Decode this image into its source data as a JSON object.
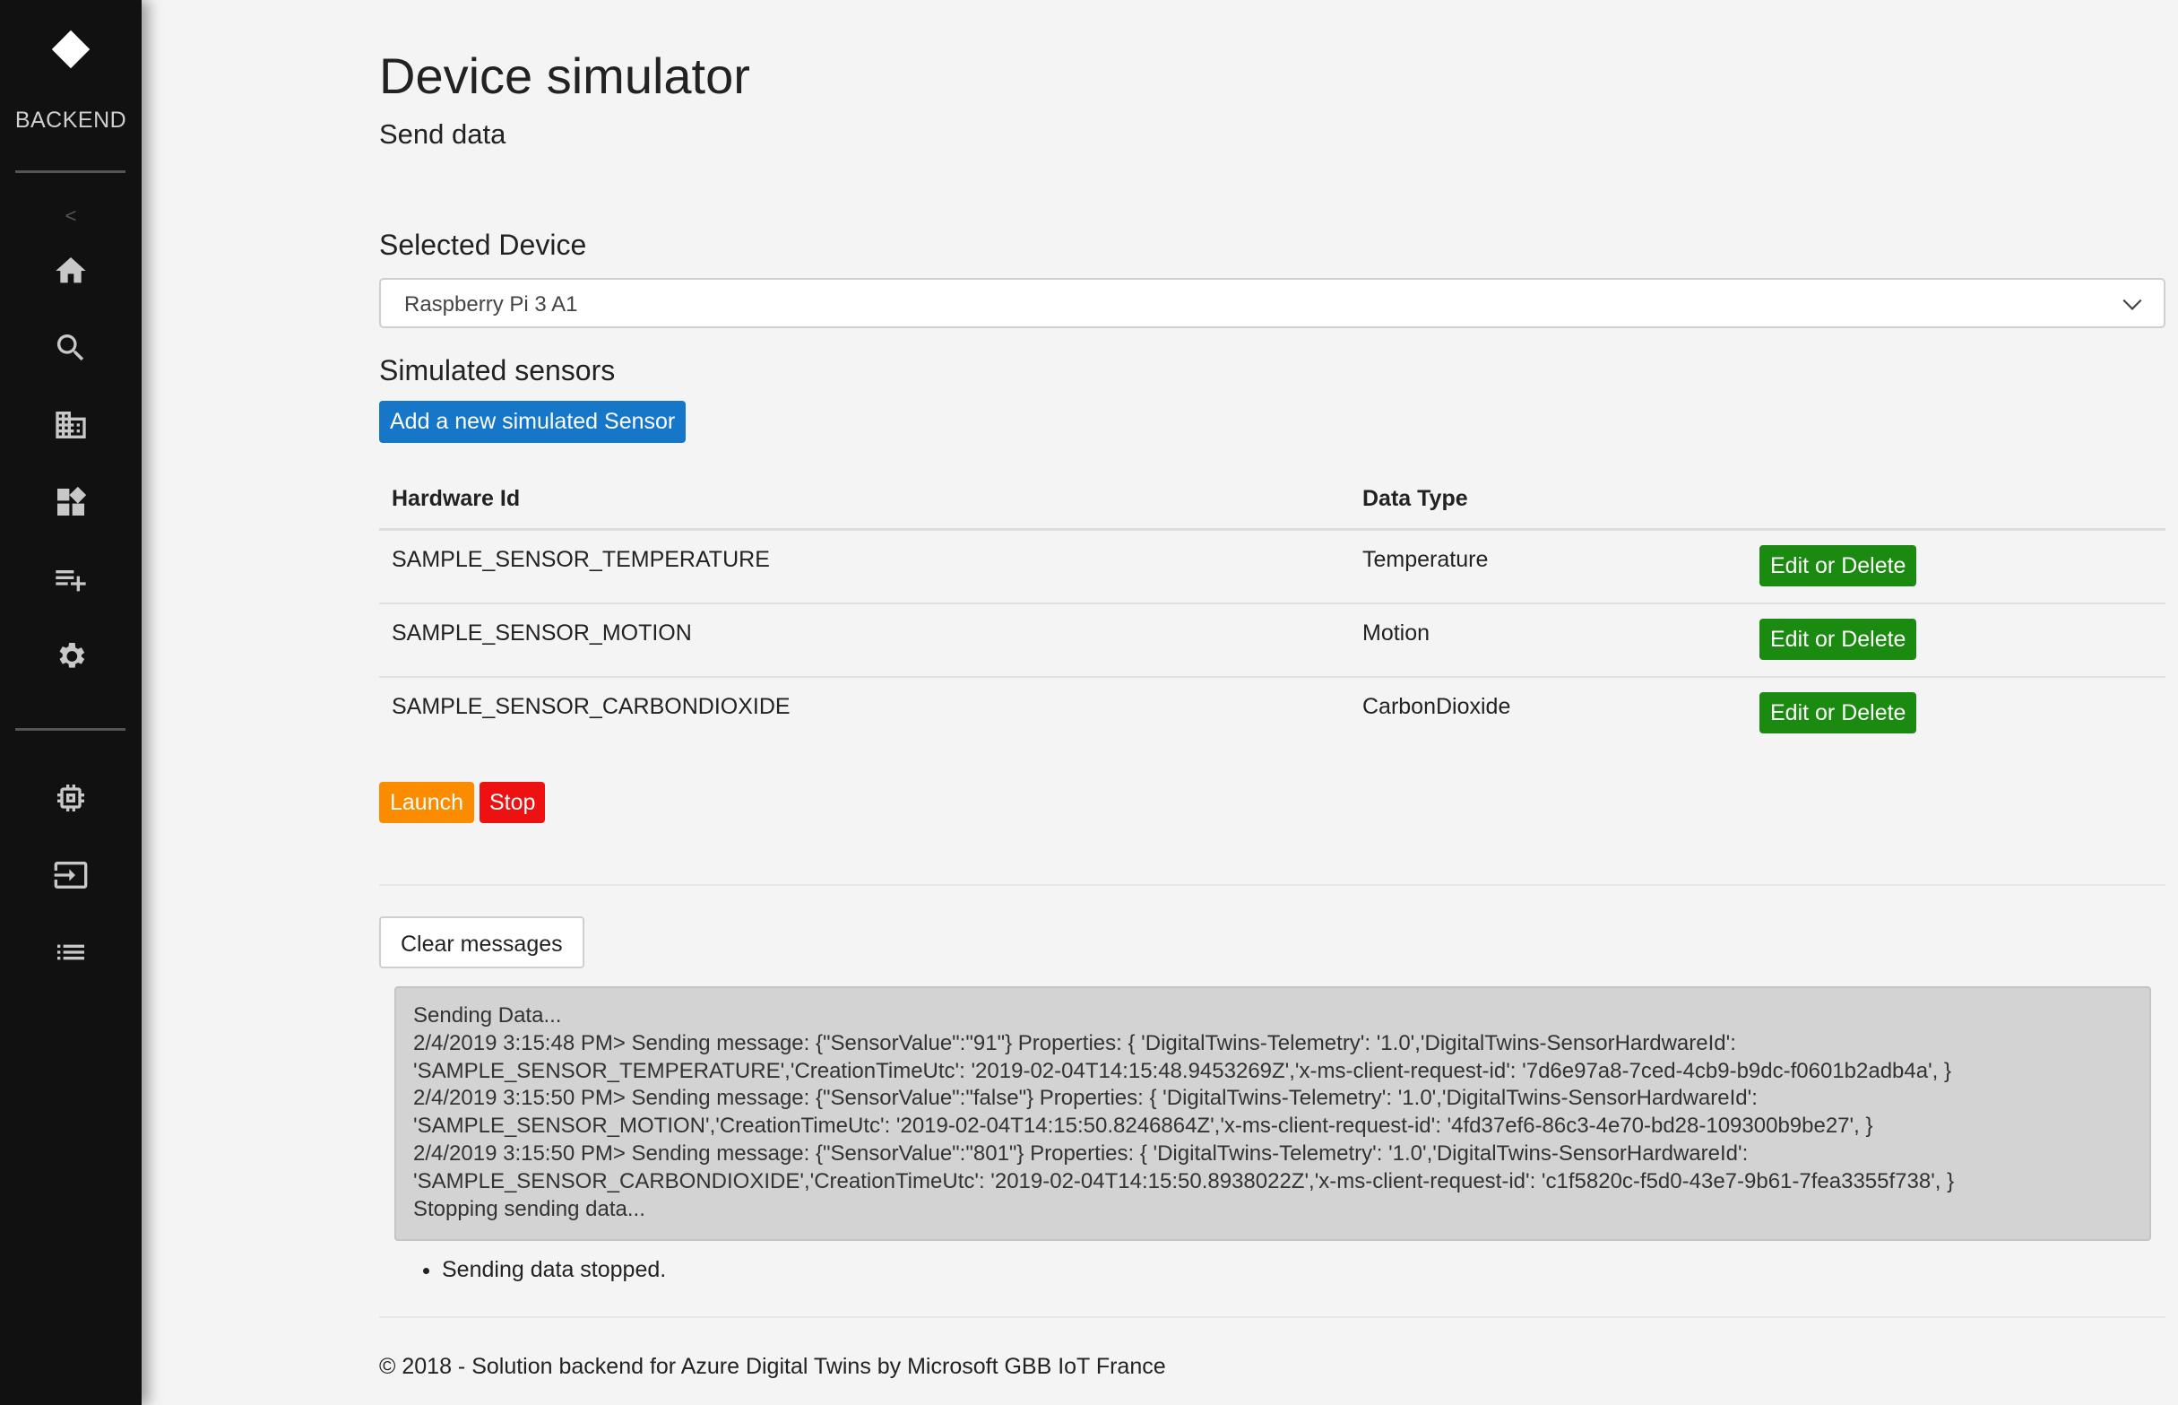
{
  "sidebar": {
    "brand": "BACKEND",
    "collapse": "<",
    "nav_top": [
      "home-icon",
      "search-icon",
      "building-icon",
      "dashboard-icon",
      "playlist-add-icon",
      "settings-icon"
    ],
    "nav_bottom": [
      "chip-icon",
      "input-icon",
      "list-icon"
    ]
  },
  "page": {
    "title": "Device simulator",
    "subtitle": "Send data"
  },
  "device": {
    "label": "Selected Device",
    "selected": "Raspberry Pi 3 A1"
  },
  "sensors": {
    "title": "Simulated sensors",
    "add_button": "Add a new simulated Sensor",
    "columns": [
      "Hardware Id",
      "Data Type"
    ],
    "rows": [
      {
        "hardware_id": "SAMPLE_SENSOR_TEMPERATURE",
        "data_type": "Temperature",
        "action": "Edit or Delete"
      },
      {
        "hardware_id": "SAMPLE_SENSOR_MOTION",
        "data_type": "Motion",
        "action": "Edit or Delete"
      },
      {
        "hardware_id": "SAMPLE_SENSOR_CARBONDIOXIDE",
        "data_type": "CarbonDioxide",
        "action": "Edit or Delete"
      }
    ]
  },
  "controls": {
    "launch": "Launch",
    "stop": "Stop",
    "clear": "Clear messages"
  },
  "log": {
    "lines": [
      "Sending Data...",
      "2/4/2019 3:15:48 PM> Sending message: {\"SensorValue\":\"91\"} Properties: { 'DigitalTwins-Telemetry': '1.0','DigitalTwins-SensorHardwareId':",
      "'SAMPLE_SENSOR_TEMPERATURE','CreationTimeUtc': '2019-02-04T14:15:48.9453269Z','x-ms-client-request-id': '7d6e97a8-7ced-4cb9-b9dc-f0601b2adb4a', }",
      "2/4/2019 3:15:50 PM> Sending message: {\"SensorValue\":\"false\"} Properties: { 'DigitalTwins-Telemetry': '1.0','DigitalTwins-SensorHardwareId':",
      "'SAMPLE_SENSOR_MOTION','CreationTimeUtc': '2019-02-04T14:15:50.8246864Z','x-ms-client-request-id': '4fd37ef6-86c3-4e70-bd28-109300b9be27', }",
      "2/4/2019 3:15:50 PM> Sending message: {\"SensorValue\":\"801\"} Properties: { 'DigitalTwins-Telemetry': '1.0','DigitalTwins-SensorHardwareId':",
      "'SAMPLE_SENSOR_CARBONDIOXIDE','CreationTimeUtc': '2019-02-04T14:15:50.8938022Z','x-ms-client-request-id': 'c1f5820c-f5d0-43e7-9b61-7fea3355f738', }",
      "Stopping sending data..."
    ],
    "status": "Sending data stopped."
  },
  "footer": "© 2018 - Solution backend for Azure Digital Twins by Microsoft GBB IoT France"
}
